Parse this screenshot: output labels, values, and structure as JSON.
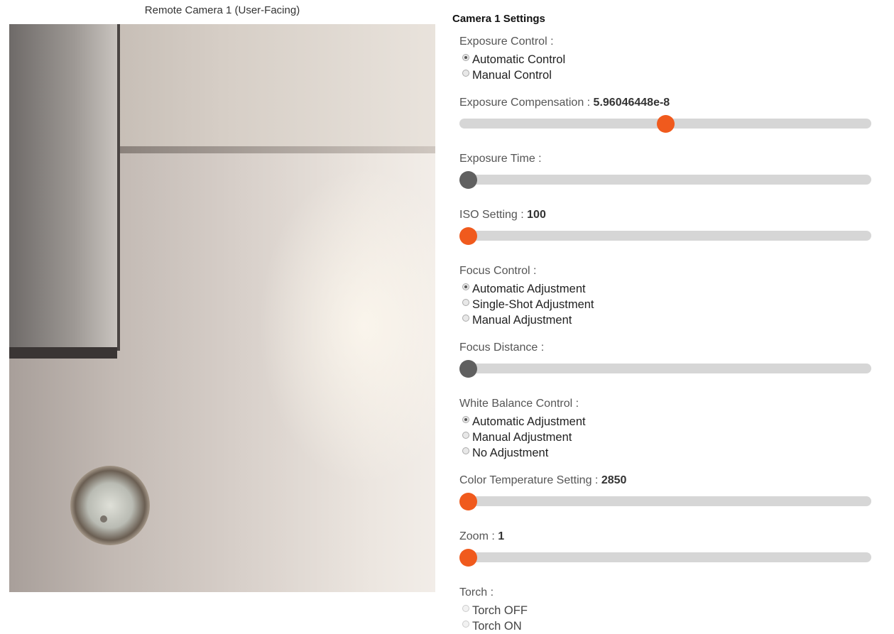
{
  "camera": {
    "caption": "Remote Camera 1 (User-Facing)"
  },
  "settings": {
    "title": "Camera 1 Settings",
    "exposure_control": {
      "label": "Exposure Control :",
      "options": [
        "Automatic Control",
        "Manual Control"
      ],
      "selected": "Automatic Control"
    },
    "exposure_compensation": {
      "label": "Exposure Compensation : ",
      "value": "5.96046448e-8",
      "slider_fraction": 0.5,
      "enabled": true
    },
    "exposure_time": {
      "label": "Exposure Time :",
      "slider_fraction": 0.0,
      "enabled": false
    },
    "iso": {
      "label": "ISO Setting : ",
      "value": "100",
      "slider_fraction": 0.0,
      "enabled": true
    },
    "focus_control": {
      "label": "Focus Control :",
      "options": [
        "Automatic Adjustment",
        "Single-Shot Adjustment",
        "Manual Adjustment"
      ],
      "selected": "Automatic Adjustment"
    },
    "focus_distance": {
      "label": "Focus Distance :",
      "slider_fraction": 0.0,
      "enabled": false
    },
    "white_balance_control": {
      "label": "White Balance Control :",
      "options": [
        "Automatic Adjustment",
        "Manual Adjustment",
        "No Adjustment"
      ],
      "selected": "Automatic Adjustment"
    },
    "color_temperature": {
      "label": "Color Temperature Setting : ",
      "value": "2850",
      "slider_fraction": 0.0,
      "enabled": true
    },
    "zoom": {
      "label": "Zoom : ",
      "value": "1",
      "slider_fraction": 0.0,
      "enabled": true
    },
    "torch": {
      "label": "Torch :",
      "options": [
        "Torch OFF",
        "Torch ON"
      ],
      "selected": null,
      "enabled": false
    }
  },
  "colors": {
    "slider_thumb_active": "#f05a1d",
    "slider_thumb_disabled": "#606060",
    "slider_track": "#d6d6d6"
  }
}
